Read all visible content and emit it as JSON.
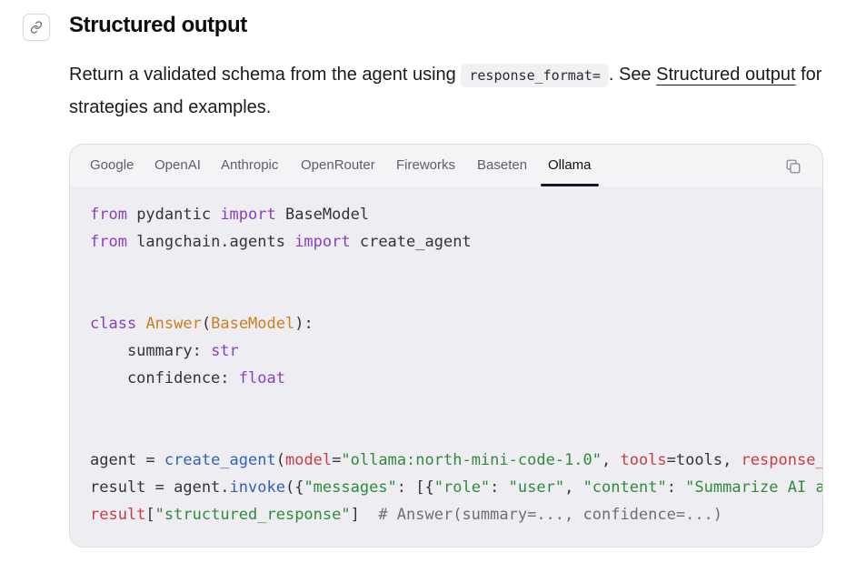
{
  "section": {
    "title": "Structured output",
    "intro_before": "Return a validated schema from the agent using ",
    "inline_code": "response_format=",
    "intro_middle": ". See ",
    "link_text": "Structured output",
    "intro_after": " for strategies and examples."
  },
  "tabs": [
    {
      "label": "Google",
      "active": false
    },
    {
      "label": "OpenAI",
      "active": false
    },
    {
      "label": "Anthropic",
      "active": false
    },
    {
      "label": "OpenRouter",
      "active": false
    },
    {
      "label": "Fireworks",
      "active": false
    },
    {
      "label": "Baseten",
      "active": false
    },
    {
      "label": "Ollama",
      "active": true
    }
  ],
  "icons": {
    "anchor": "link-icon",
    "copy": "copy-icon"
  },
  "code": {
    "l1": {
      "kw1": "from",
      "mod": " pydantic ",
      "kw2": "import",
      "name": " BaseModel"
    },
    "l2": {
      "kw1": "from",
      "mod": " langchain.agents ",
      "kw2": "import",
      "name": " create_agent"
    },
    "l5": {
      "kw": "class",
      "cls": "Answer",
      "p1": "(",
      "base": "BaseModel",
      "p2": "):"
    },
    "l6": {
      "name": "    summary: ",
      "type": "str"
    },
    "l7": {
      "name": "    confidence: ",
      "type": "float"
    },
    "l10": {
      "var": "agent = ",
      "fn": "create_agent",
      "p1": "(",
      "model_kw": "model",
      "eq1": "=",
      "model_val": "\"ollama:north-mini-code-1.0\"",
      "c1": ", ",
      "tools_kw": "tools",
      "eq2": "=tools, ",
      "resp_kw": "response_format"
    },
    "l11": {
      "var": "result = agent.",
      "fn": "invoke",
      "p1": "({",
      "s1": "\"messages\"",
      "c1": ": [{",
      "s2": "\"role\"",
      "c2": ": ",
      "s3": "\"user\"",
      "c3": ", ",
      "s4": "\"content\"",
      "c4": ": ",
      "s5": "\"Summarize AI agents\""
    },
    "l12": {
      "var": "result",
      "p1": "[",
      "key": "\"structured_response\"",
      "p2": "]  ",
      "comment": "# Answer(summary=..., confidence=...)"
    }
  },
  "colors": {
    "keyword": "#8a3fc2",
    "class": "#cf7d1d",
    "function": "#2f62b8",
    "string": "#2f8b3c",
    "parameter": "#cc3a43",
    "comment": "#6e6e78",
    "active_tab_underline": "#15152a"
  }
}
